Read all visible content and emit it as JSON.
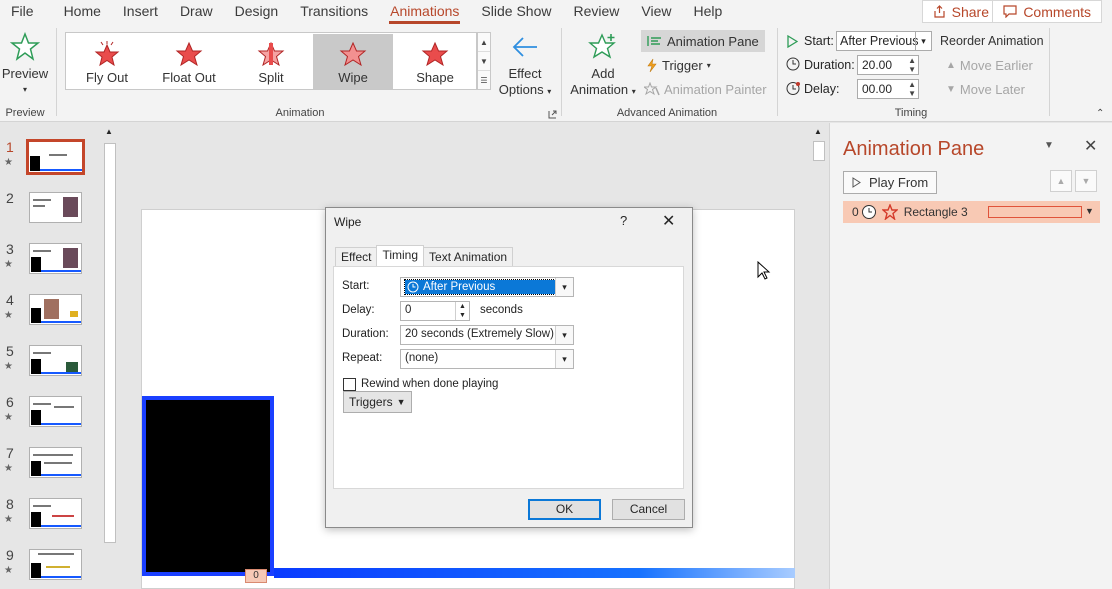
{
  "menu": {
    "items": [
      "File",
      "Home",
      "Insert",
      "Draw",
      "Design",
      "Transitions",
      "Animations",
      "Slide Show",
      "Review",
      "View",
      "Help"
    ],
    "active_index": 6,
    "share": "Share",
    "comments": "Comments"
  },
  "ribbon": {
    "preview": {
      "label": "Preview",
      "group": "Preview"
    },
    "animation_gallery": {
      "items": [
        "Fly Out",
        "Float Out",
        "Split",
        "Wipe",
        "Shape"
      ],
      "selected_index": 3,
      "effect_options_line1": "Effect",
      "effect_options_line2": "Options",
      "group": "Animation"
    },
    "advanced": {
      "add_line1": "Add",
      "add_line2": "Animation",
      "animation_pane": "Animation Pane",
      "trigger": "Trigger",
      "painter": "Animation Painter",
      "group": "Advanced Animation"
    },
    "timing": {
      "start_label": "Start:",
      "start_value": "After Previous",
      "duration_label": "Duration:",
      "duration_value": "20.00",
      "delay_label": "Delay:",
      "delay_value": "00.00",
      "reorder": "Reorder Animation",
      "move_earlier": "Move Earlier",
      "move_later": "Move Later",
      "group": "Timing"
    }
  },
  "thumbnails": {
    "slides": [
      "1",
      "2",
      "3",
      "4",
      "5",
      "6",
      "7",
      "8",
      "9"
    ],
    "active_index": 0
  },
  "slide": {
    "animation_tag": "0"
  },
  "animation_pane": {
    "title": "Animation Pane",
    "play_from": "Play From",
    "item_number": "0",
    "item_name": "Rectangle 3"
  },
  "dialog": {
    "title": "Wipe",
    "help": "?",
    "tabs": [
      "Effect",
      "Timing",
      "Text Animation"
    ],
    "active_tab": 1,
    "start_label": "Start:",
    "start_value": "After Previous",
    "delay_label": "Delay:",
    "delay_value": "0",
    "delay_unit": "seconds",
    "duration_label": "Duration:",
    "duration_value": "20 seconds (Extremely Slow)",
    "repeat_label": "Repeat:",
    "repeat_value": "(none)",
    "rewind_label": "Rewind when done playing",
    "triggers": "Triggers",
    "ok": "OK",
    "cancel": "Cancel"
  },
  "colors": {
    "accent": "#b7472a",
    "selection": "#0b78d7",
    "slide_bar": "#1659ff"
  }
}
